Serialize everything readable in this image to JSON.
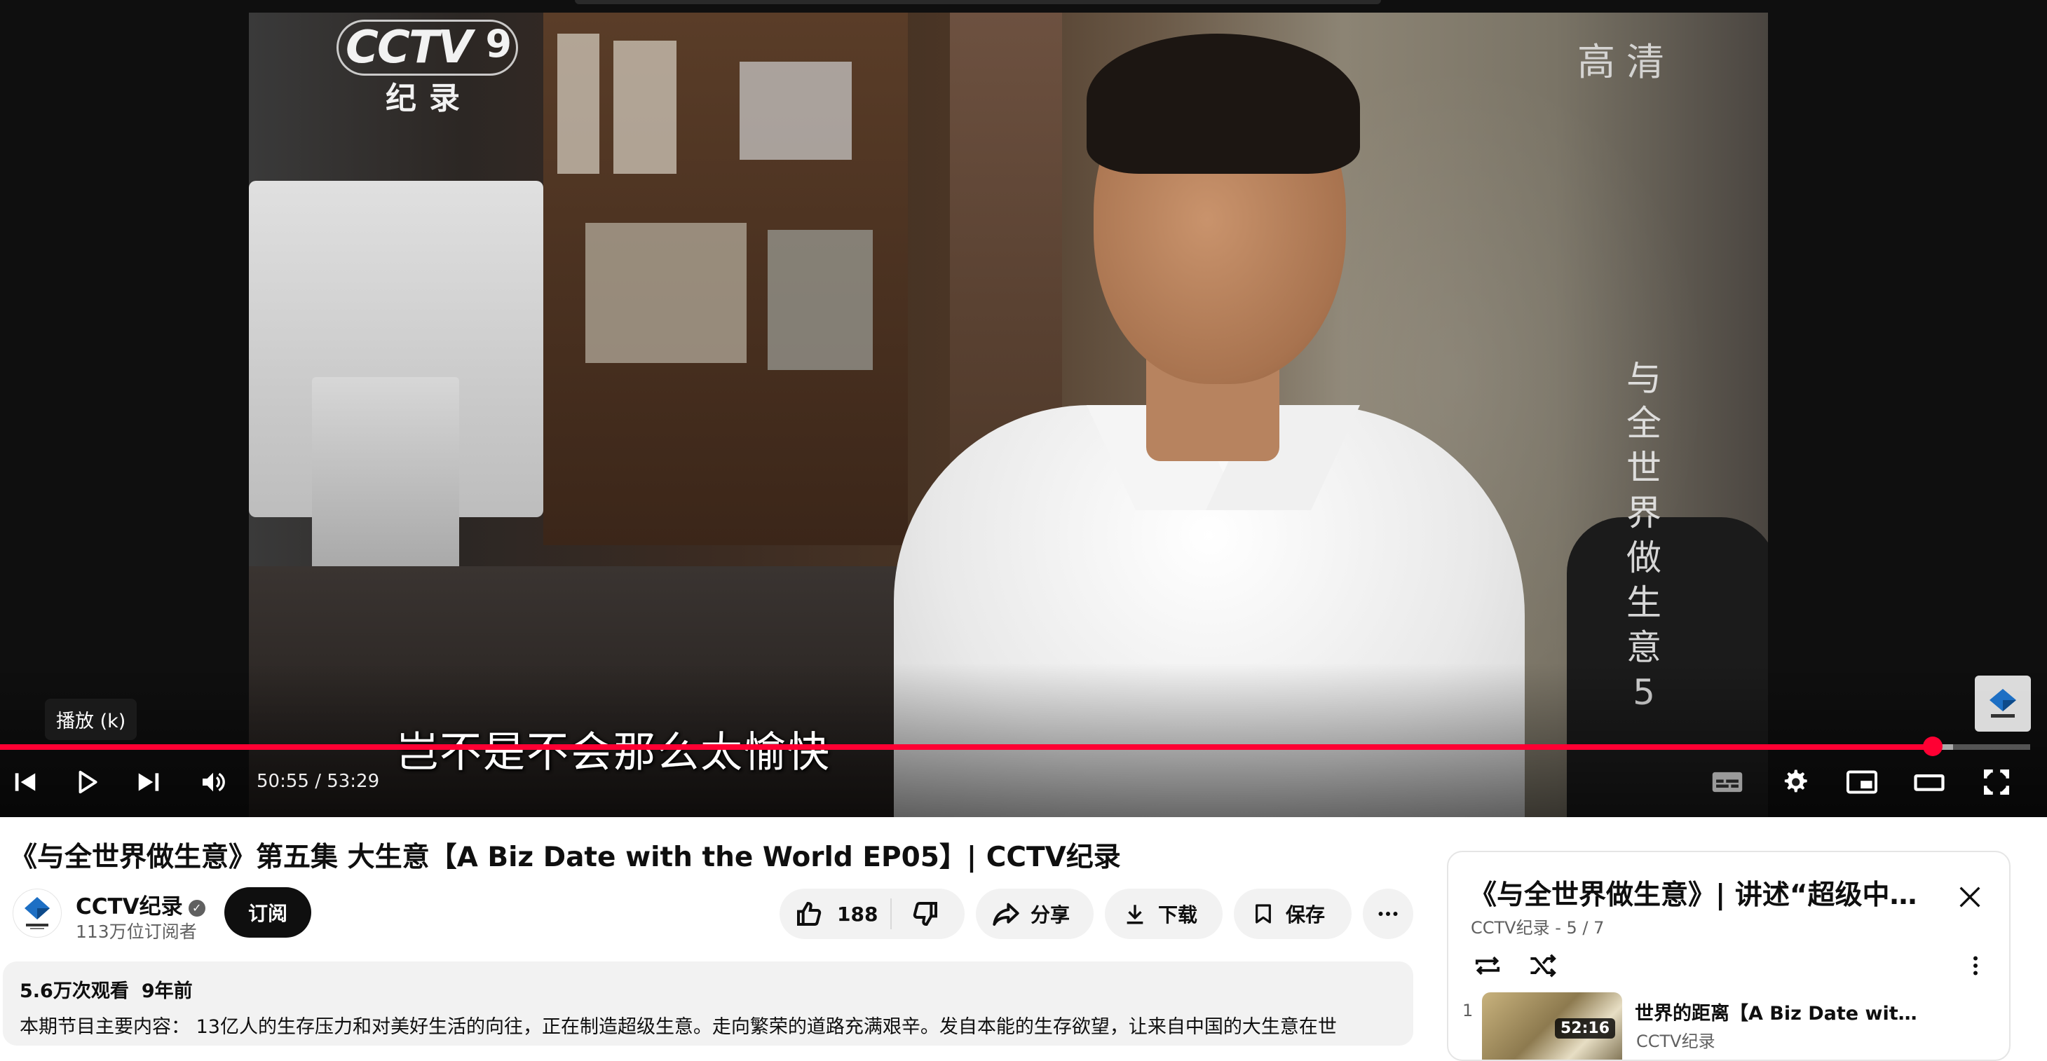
{
  "player": {
    "logo": {
      "brand": "CCTV",
      "channel_number": "9",
      "sub": "纪录"
    },
    "hd_badge": "高清",
    "vertical_title": "与全世界做生意5",
    "subtitle": "岂不是不会那么太愉快",
    "tooltip": "播放 (k)",
    "time_display": "50:55 / 53:29",
    "progress_fraction": 0.9519,
    "buffered_fraction": 0.962,
    "accent_color": "#ff0033",
    "icons": {
      "prev": "skip-previous-icon",
      "play": "play-icon",
      "next": "skip-next-icon",
      "volume": "volume-icon",
      "subtitles": "subtitles-icon",
      "settings": "gear-icon",
      "miniplayer": "miniplayer-icon",
      "theater": "theater-mode-icon",
      "fullscreen": "fullscreen-icon"
    }
  },
  "video": {
    "title": "《与全世界做生意》第五集 大生意【A Biz Date with the World EP05】| CCTV纪录",
    "channel": {
      "name": "CCTV纪录",
      "subscribers": "113万位订阅者",
      "verified": true,
      "subscribe_label": "订阅"
    },
    "actions": {
      "like_count": "188",
      "share_label": "分享",
      "download_label": "下载",
      "save_label": "保存"
    },
    "description": {
      "views": "5.6万次观看",
      "age": "9年前",
      "text": "本期节目主要内容： 13亿人的生存压力和对美好生活的向往，正在制造超级生意。走向繁荣的道路充满艰辛。发自本能的生存欲望，让来自中国的大生意在世"
    }
  },
  "playlist": {
    "title": "《与全世界做生意》| 讲述“超级中国…",
    "subtitle": "CCTV纪录 - 5 / 7",
    "items": [
      {
        "index": "1",
        "title": "世界的距离【A Biz Date with…",
        "channel": "CCTV纪录",
        "duration": "52:16"
      }
    ]
  }
}
